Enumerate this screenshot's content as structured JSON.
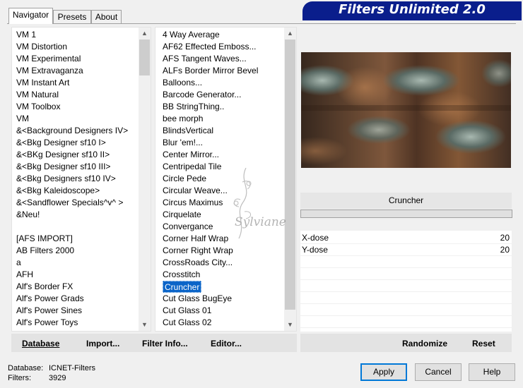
{
  "tabs": [
    "Navigator",
    "Presets",
    "About"
  ],
  "banner_title": "Filters Unlimited 2.0",
  "categories": [
    "VM 1",
    "VM Distortion",
    "VM Experimental",
    "VM Extravaganza",
    "VM Instant Art",
    "VM Natural",
    "VM Toolbox",
    "VM",
    "&<Background Designers IV>",
    "&<Bkg Designer sf10 I>",
    "&<BKg Designer sf10 II>",
    "&<Bkg Designer sf10 III>",
    "&<Bkg Designers sf10 IV>",
    "&<Bkg Kaleidoscope>",
    "&<Sandflower Specials^v^ >",
    "&Neu!",
    "",
    "[AFS IMPORT]",
    "AB Filters 2000",
    "a",
    "AFH",
    "Alf's Border FX",
    "Alf's Power Grads",
    "Alf's Power Sines",
    "Alf's Power Toys"
  ],
  "filters": [
    "4 Way Average",
    "AF62 Effected Emboss...",
    "AFS Tangent Waves...",
    "ALFs Border Mirror Bevel",
    "Balloons...",
    "Barcode Generator...",
    "BB StringThing..",
    "bee morph",
    "BlindsVertical",
    "Blur 'em!...",
    "Center Mirror...",
    "Centripedal Tile",
    "Circle Pede",
    "Circular Weave...",
    "Circus Maximus",
    "Cirquelate",
    "Convergance",
    "Corner Half Wrap",
    "Corner Right Wrap",
    "CrossRoads City...",
    "Crosstitch",
    "Cruncher",
    "Cut Glass  BugEye",
    "Cut Glass 01",
    "Cut Glass 02"
  ],
  "selected_filter": "Cruncher",
  "filter_name": "Cruncher",
  "params": [
    {
      "name": "X-dose",
      "value": "20"
    },
    {
      "name": "Y-dose",
      "value": "20"
    }
  ],
  "toolbar": {
    "database": "Database",
    "import": "Import...",
    "filter_info": "Filter Info...",
    "editor": "Editor...",
    "randomize": "Randomize",
    "reset": "Reset"
  },
  "status": {
    "database_label": "Database:",
    "database_value": "ICNET-Filters",
    "filters_label": "Filters:",
    "filters_value": "3929"
  },
  "buttons": {
    "apply": "Apply",
    "cancel": "Cancel",
    "help": "Help"
  },
  "watermark_text": "Sylviane",
  "colors": {
    "banner": "#0a1e8c",
    "selection": "#0a64c8",
    "focus": "#0078d7"
  }
}
